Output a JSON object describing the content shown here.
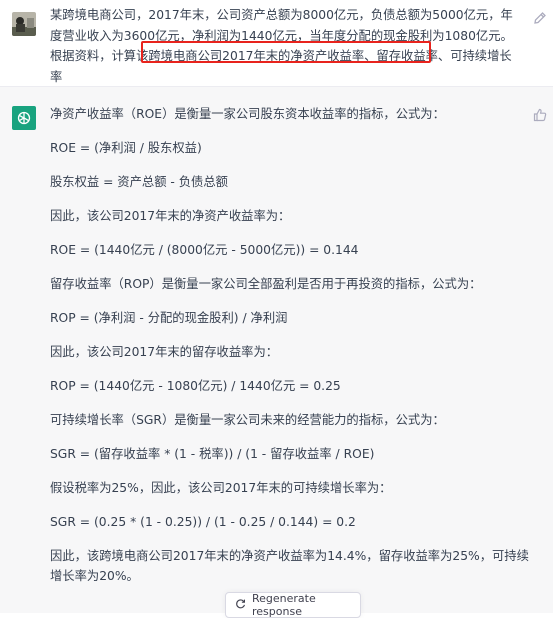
{
  "user": {
    "message_before": "某跨境电商公司，2017年末，公司资产总额为8000亿元，负债总额为5000亿元，年度营业收入为3600亿元，净利润为1440亿元，当年度分配的现金股利为1080亿元。根据资料，计算该跨境电商公司",
    "message_highlight": "2017年末的净资产收益率、留存收益率、可持续增长率"
  },
  "assistant": {
    "paragraphs": [
      "净资产收益率（ROE）是衡量一家公司股东资本收益率的指标，公式为：",
      "ROE = (净利润 / 股东权益)",
      "股东权益 = 资产总额 - 负债总额",
      "因此，该公司2017年末的净资产收益率为：",
      "ROE = (1440亿元 / (8000亿元 - 5000亿元)) = 0.144",
      "留存收益率（ROP）是衡量一家公司全部盈利是否用于再投资的指标，公式为：",
      "ROP = (净利润 - 分配的现金股利) / 净利润",
      "因此，该公司2017年末的留存收益率为：",
      "ROP = (1440亿元 - 1080亿元) / 1440亿元 = 0.25",
      "可持续增长率（SGR）是衡量一家公司未来的经营能力的指标，公式为：",
      "SGR = (留存收益率 * (1 - 税率)) / (1 - 留存收益率 / ROE)",
      "假设税率为25%，因此，该公司2017年末的可持续增长率为：",
      "SGR = (0.25 * (1 - 0.25)) / (1 - 0.25 / 0.144) = 0.2",
      "因此，该跨境电商公司2017年末的净资产收益率为14.4%，留存收益率为25%，可持续增长率为20%。"
    ]
  },
  "regenerate_label": "Regenerate response",
  "colors": {
    "highlight_border": "#e8231d",
    "assistant_bg": "#f7f7f8",
    "gpt_green": "#19a37f"
  }
}
